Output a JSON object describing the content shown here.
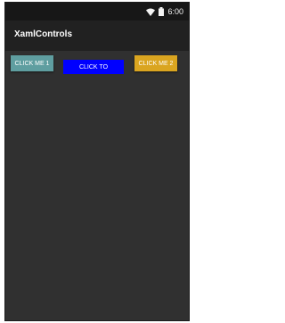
{
  "status_bar": {
    "time": "6:00",
    "icons": [
      "wifi-icon",
      "battery-icon"
    ]
  },
  "app_bar": {
    "title": "XamlControls"
  },
  "buttons": [
    {
      "label": "CLICK ME 1",
      "color": "#5f9ea0"
    },
    {
      "label": "CLICK TO",
      "color": "#0000ff"
    },
    {
      "label": "CLICK ME 2",
      "color": "#daa520"
    }
  ],
  "colors": {
    "background": "#303030",
    "app_bar": "#212121",
    "status_bar": "#171717"
  }
}
